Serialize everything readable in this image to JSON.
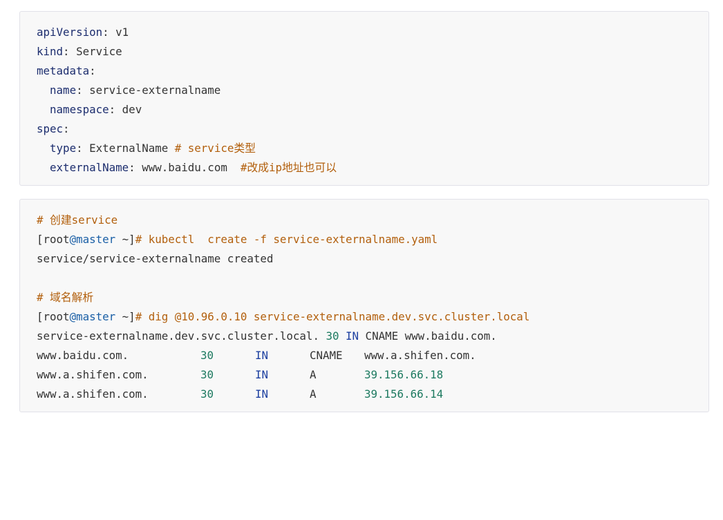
{
  "yaml_block": {
    "lines": [
      {
        "key": "apiVersion",
        "sep": ": ",
        "value": "v1"
      },
      {
        "key": "kind",
        "sep": ": ",
        "value": "Service"
      },
      {
        "key": "metadata",
        "sep": ":",
        "value": ""
      },
      {
        "indent": "  ",
        "key": "name",
        "sep": ": ",
        "value": "service-externalname"
      },
      {
        "indent": "  ",
        "key": "namespace",
        "sep": ": ",
        "value": "dev"
      },
      {
        "key": "spec",
        "sep": ":",
        "value": ""
      },
      {
        "indent": "  ",
        "key": "type",
        "sep": ": ",
        "value": "ExternalName ",
        "comment": "# service类型"
      },
      {
        "indent": "  ",
        "key": "externalName",
        "sep": ": ",
        "value": "www.baidu.com  ",
        "comment": "#改成ip地址也可以"
      }
    ]
  },
  "shell_block": {
    "comment_create": "# 创建service",
    "prompt": {
      "open": "[root",
      "at_host": "@master",
      "close": " ~]",
      "hash": "#"
    },
    "cmd_create": " kubectl  create -f service-externalname.yaml",
    "output_create": "service/service-externalname created",
    "comment_dns": "# 域名解析",
    "cmd_dig": " dig @10.96.0.10 service-externalname.dev.svc.cluster.local",
    "answer_line": {
      "name": "service-externalname.dev.svc.cluster.local. ",
      "ttl": "30",
      "class": " IN",
      "rest": " CNAME www.baidu.com."
    },
    "records": [
      {
        "name": "www.baidu.com.",
        "ttl": "30",
        "class": "IN",
        "type": "CNAME",
        "data": "www.a.shifen.com."
      },
      {
        "name": "www.a.shifen.com.",
        "ttl": "30",
        "class": "IN",
        "type": "A",
        "data": "39.156.66.18"
      },
      {
        "name": "www.a.shifen.com.",
        "ttl": "30",
        "class": "IN",
        "type": "A",
        "data": "39.156.66.14"
      }
    ]
  },
  "colors": {
    "block_background": "#f8f8f8",
    "block_border": "#e1e1e8",
    "key": "#1c2d6e",
    "comment": "#b25f0c",
    "hostname": "#1a5fa6",
    "number": "#1d7a60",
    "text": "#333333"
  }
}
